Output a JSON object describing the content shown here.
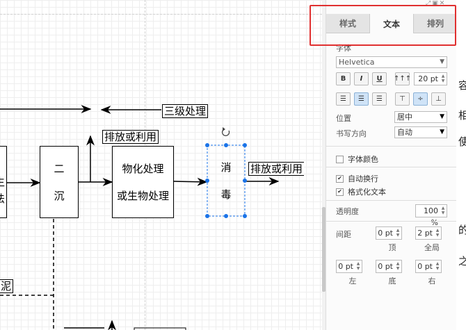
{
  "canvas": {
    "labels": {
      "level3": "三级处理",
      "discharge_top": "排放或利用",
      "discharge_right": "排放或利用",
      "sludge": "泥",
      "left_cut_1": "生",
      "left_cut_2": "法"
    },
    "nodes": {
      "secondary_sed_line1": "二",
      "secondary_sed_line2": "沉",
      "physchem_line1": "物化处理",
      "physchem_line2": "或生物处理",
      "disinfect_line1": "消",
      "disinfect_line2": "毒"
    },
    "rotate_icon": "rotate-icon"
  },
  "panel": {
    "tabs": [
      "样式",
      "文本",
      "排列"
    ],
    "active_tab": "文本",
    "font_section_label": "字体",
    "font_family": "Helvetica",
    "bold": "B",
    "italic": "I",
    "underline": "U",
    "font_size": "20 pt",
    "position_label": "位置",
    "position_value": "居中",
    "writing_dir_label": "书写方向",
    "writing_dir_value": "自动",
    "font_color_label": "字体颜色",
    "auto_wrap_label": "自动换行",
    "formatted_text_label": "格式化文本",
    "opacity_label": "透明度",
    "opacity_value": "100 %",
    "spacing_label": "间距",
    "spacing_top_value": "0 pt",
    "spacing_global_value": "2 pt",
    "spacing_top_label": "顶",
    "spacing_global_label": "全局",
    "spacing_left_value": "0 pt",
    "spacing_bottom_value": "0 pt",
    "spacing_right_value": "0 pt",
    "spacing_left_label": "左",
    "spacing_bottom_label": "底",
    "spacing_right_label": "右"
  },
  "right_edge_glyphs": [
    "容",
    "相",
    "使",
    "的",
    "之"
  ],
  "accent_color": "#1a73e8",
  "highlight_color": "#e03030"
}
